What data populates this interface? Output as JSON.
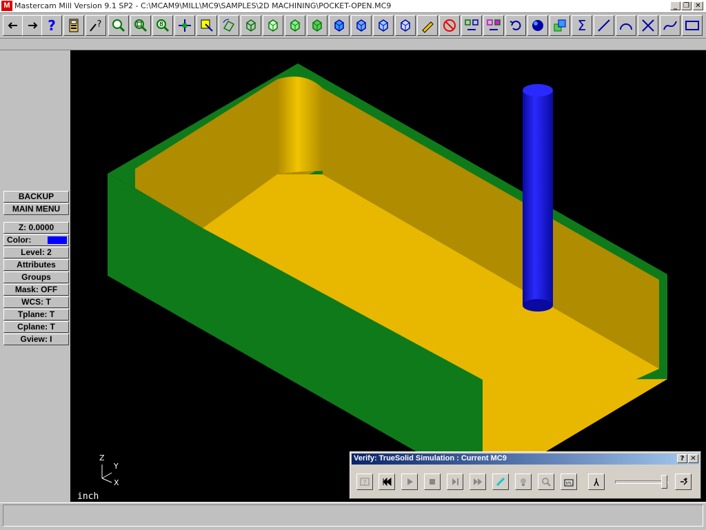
{
  "window": {
    "title": "Mastercam Mill Version 9.1 SP2 - C:\\MCAM9\\MILL\\MC9\\SAMPLES\\2D MACHINING\\POCKET-OPEN.MC9",
    "app_icon": "M"
  },
  "toolbar": {
    "icons": [
      "arrow-left-icon",
      "arrow-right-icon",
      "help-icon",
      "calculator-icon",
      "query-icon",
      "zoom-window-icon",
      "zoom-fit-icon",
      "zoom-8-icon",
      "pan-icon",
      "select-edit-icon",
      "rotate-icon",
      "cube-wire-icon",
      "cube-top-icon",
      "cube-front-icon",
      "cube-side-icon",
      "cube-iso-blue-icon",
      "cube-blue-2-icon",
      "cube-blue-3-icon",
      "cube-blue-4-icon",
      "pencil-icon",
      "no-delete-icon",
      "xform-translate-icon",
      "xform-mirror-icon",
      "undo-icon",
      "shade-sphere-icon",
      "solids-icon",
      "sigma-icon",
      "line-icon",
      "arc-icon",
      "trim-icon",
      "spline-icon",
      "rectangle-icon"
    ]
  },
  "menu": {
    "backup": "BACKUP",
    "main_menu": "MAIN MENU",
    "z": "Z:  0.0000",
    "color": "Color:",
    "color_value": "9",
    "level": "Level:  2",
    "attributes": "Attributes",
    "groups": "Groups",
    "mask": "Mask:  OFF",
    "wcs": "WCS:   T",
    "tplane": "Tplane:  T",
    "cplane": "Cplane:  T",
    "gview": "Gview:   I"
  },
  "viewport": {
    "units": "inch",
    "axis_z": "Z",
    "axis_y": "Y",
    "axis_x": "X",
    "colors": {
      "wall": "#0f7a1a",
      "floor": "#e8b800",
      "inner_wall": "#b08c00",
      "tool": "#1a1ae6"
    }
  },
  "verify_dialog": {
    "title": "Verify: TrueSolid Simulation : Current MC9",
    "help_label": "?",
    "close_label": "✕",
    "buttons": [
      "options-icon",
      "rewind-icon",
      "play-icon",
      "stop-icon",
      "step-icon",
      "fast-forward-icon",
      "cutter-icon",
      "lightbulb-icon",
      "inspect-icon",
      "stl-icon",
      "speed-slow-icon",
      "speed-fast-icon"
    ],
    "speed_fraction": 0.95
  }
}
